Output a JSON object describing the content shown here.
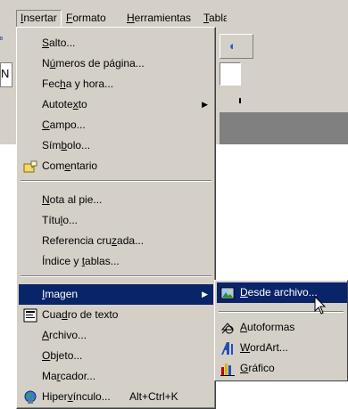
{
  "menubar": {
    "items": [
      {
        "id": "insertar",
        "label": "Insertar"
      },
      {
        "id": "formato",
        "label": "Formato"
      },
      {
        "id": "herramientas",
        "label": "Herramientas"
      },
      {
        "id": "tabla",
        "label": "Tabla"
      }
    ],
    "left_edge_fragment": "N"
  },
  "insert_menu": {
    "items": [
      {
        "label": "Salto...",
        "underline": "S"
      },
      {
        "label": "Números de página...",
        "underline": "ú"
      },
      {
        "label": "Fecha y hora...",
        "underline": "h"
      },
      {
        "label": "Autotexto",
        "underline": "x",
        "submenu_arrow": "▶"
      },
      {
        "label": "Campo...",
        "underline": "C"
      },
      {
        "label": "Símbolo...",
        "underline": "b"
      },
      {
        "label": "Comentario",
        "underline": "e",
        "icon": "comment-icon"
      },
      {
        "label": "Nota al pie...",
        "underline": "N"
      },
      {
        "label": "Título...",
        "underline": "l"
      },
      {
        "label": "Referencia cruzada...",
        "underline": "z"
      },
      {
        "label": "Índice y tablas...",
        "underline": "t"
      },
      {
        "label": "Imagen",
        "underline": "I",
        "submenu_arrow": "▶",
        "highlighted": true
      },
      {
        "label": "Cuadro de texto",
        "underline": "d",
        "icon": "textbox-icon"
      },
      {
        "label": "Archivo...",
        "underline": "A"
      },
      {
        "label": "Objeto...",
        "underline": "O"
      },
      {
        "label": "Marcador...",
        "underline": "r"
      },
      {
        "label": "Hipervínculo...",
        "underline": "v",
        "shortcut": "Alt+Ctrl+K",
        "icon": "hyperlink-globe-icon"
      }
    ]
  },
  "image_submenu": {
    "items": [
      {
        "label": "Desde archivo...",
        "underline": "D",
        "icon": "picture-file-icon",
        "highlighted": true
      },
      {
        "label": "Autoformas",
        "underline": "A",
        "icon": "autoshapes-icon"
      },
      {
        "label": "WordArt...",
        "underline": "W",
        "icon": "wordart-icon"
      },
      {
        "label": "Gráfico",
        "underline": "G",
        "icon": "chart-icon"
      }
    ]
  },
  "colors": {
    "menu_face": "#d4d0c8",
    "highlight": "#0a246a",
    "highlight_text": "#ffffff",
    "shadow": "#808080"
  }
}
